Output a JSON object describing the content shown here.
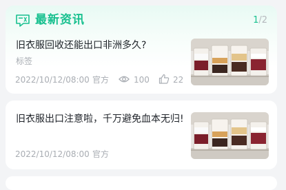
{
  "section": {
    "icon": "news-icon",
    "title": "最新资讯",
    "pager_current": "1",
    "pager_total": "/2",
    "accent": "#18c08f"
  },
  "articles": [
    {
      "title": "旧衣服回收还能出口非洲多久?",
      "tag": "标签",
      "date": "2022/10/12/08:00",
      "source": "官方",
      "views": "100",
      "likes": "22",
      "thumbnail": "cups-photo"
    },
    {
      "title": "旧衣服出口注意啦，千万避免血本无归!",
      "date": "2022/10/12/08:00",
      "source": "官方",
      "thumbnail": "cups-photo"
    }
  ]
}
